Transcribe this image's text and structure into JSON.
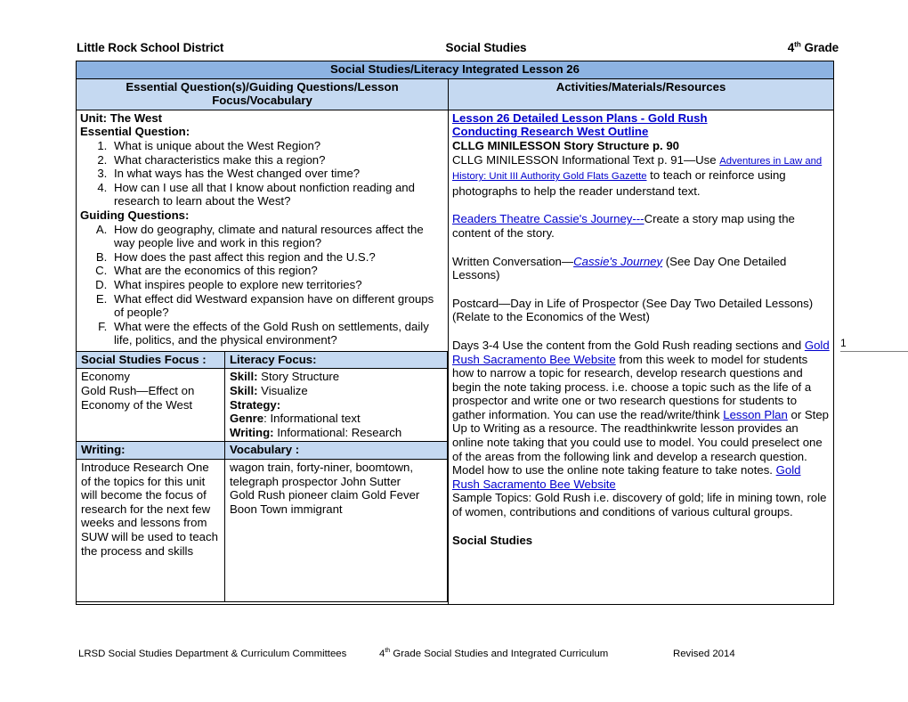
{
  "header": {
    "district": "Little Rock School District",
    "subject": "Social Studies",
    "grade_num": "4",
    "grade_sup": "th",
    "grade_word": " Grade"
  },
  "page_marker": {
    "number": "1"
  },
  "table": {
    "title": "Social Studies/Literacy Integrated Lesson 26",
    "col_headers": {
      "left": "Essential Question(s)/Guiding Questions/Lesson Focus/Vocabulary",
      "right": "Activities/Materials/Resources"
    }
  },
  "left_column": {
    "unit_label": "Unit:  The West",
    "essential_question_label": "Essential Question:",
    "essential_questions": [
      "What is unique about the West Region?",
      "What characteristics make this a region?",
      "In what ways has the West changed over time?",
      "How can I use all that I know about nonfiction reading and research to learn about the West?"
    ],
    "guiding_questions_label": "Guiding Questions:",
    "guiding_questions": [
      "How do geography, climate and natural resources affect the way people live and work in this region?",
      "How does the past affect this region and the U.S.?",
      "What are the economics of this region?",
      "What inspires people to explore new territories?",
      "What effect did Westward expansion have on different groups of people?",
      "What were the effects of the Gold Rush on settlements, daily life, politics, and the physical environment?"
    ],
    "focus_table": {
      "social_studies_focus_header": "Social Studies Focus :",
      "literacy_focus_header": "Literacy Focus:",
      "social_studies_focus_body": [
        "Economy",
        "Gold Rush—Effect on Economy of the West"
      ],
      "literacy_focus_rows": [
        {
          "label": "Skill:",
          "value": " Story Structure"
        },
        {
          "label": "Skill:",
          "value": " Visualize"
        },
        {
          "label": "Strategy:",
          "value": ""
        },
        {
          "label": "Genre",
          "value": ": Informational text"
        },
        {
          "label": "Writing:",
          "value": " Informational:  Research"
        }
      ],
      "writing_header": "Writing:",
      "vocabulary_header": "Vocabulary :",
      "writing_body": "Introduce Research One of the topics for this unit will become the focus of research for the next few weeks and lessons from SUW will be used to teach the process and skills",
      "vocabulary_lines": [
        "wagon train, forty-niner, boomtown,",
        "telegraph prospector  John Sutter",
        "Gold Rush  pioneer  claim  Gold Fever",
        "Boon Town  immigrant"
      ]
    }
  },
  "right_column": {
    "link_lesson_plans": "Lesson 26 Detailed Lesson Plans - Gold Rush",
    "link_conducting_research": "Conducting Research West Outline",
    "minilesson_story_structure": "CLLG MINILESSON Story Structure p. 90",
    "info_text_pre": "CLLG MINILESSON Informational Text p. 91—Use ",
    "link_adventures": "Adventures in Law and History:  Unit III Authority Gold Flats Gazette",
    "info_text_post": " to teach or reinforce using photographs to help the reader understand text.",
    "link_readers_theatre": "Readers Theatre Cassie's Journey---",
    "readers_theatre_post": "Create a story map using the content of the story.",
    "written_conv_pre": "Written Conversation—",
    "link_cassies_journey": "Cassie's Journey",
    "written_conv_post": " (See Day One Detailed Lessons)",
    "postcard_line": "Postcard—Day in Life of Prospector (See Day Two Detailed Lessons)",
    "relate_line": "(Relate to the Economics of the West)",
    "days_pre": "Days 3-4 Use the content from the Gold Rush reading sections and ",
    "link_sacbee_1": "Gold Rush Sacramento Bee Website",
    "days_mid": " from this week to model for students how to narrow a topic for research, develop research questions and begin the note taking process.  i.e. choose a topic such as the life of a prospector and write one or two research questions for students to gather information.  You can use the read/write/think ",
    "link_lesson_plan": "Lesson Plan",
    "days_post": " or Step Up to Writing as a resource. The readthinkwrite lesson provides an online note taking that you could use to model.  You could preselect one of the areas from the following link and develop a research question.  Model how to use the online note taking feature to take notes. ",
    "link_sacbee_2": "Gold Rush Sacramento Bee Website",
    "sample_topics": "Sample Topics:  Gold Rush i.e. discovery of gold; life in mining town, role of women, contributions and conditions of various cultural groups.",
    "social_studies_heading": "Social Studies"
  },
  "footer": {
    "left": "LRSD Social Studies Department & Curriculum Committees",
    "center_num": "4",
    "center_sup": "th",
    "center_rest": " Grade Social Studies and Integrated Curriculum",
    "right": "Revised 2014"
  },
  "colors": {
    "title_band": "#8db3e2",
    "subheader_band": "#c5d9f1",
    "link": "#0000cd"
  }
}
